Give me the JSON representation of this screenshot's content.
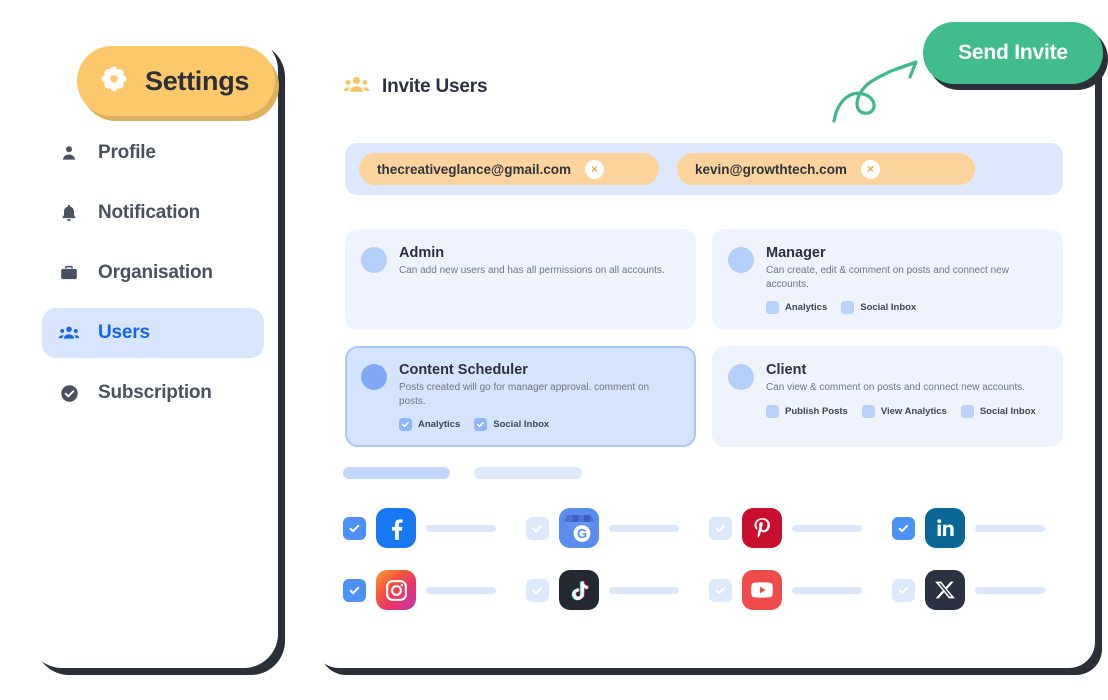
{
  "sidebar": {
    "header": {
      "label": "Settings",
      "icon": "flower-gear-icon",
      "bg": "#fcc86a"
    },
    "items": [
      {
        "label": "Profile",
        "icon": "person-icon",
        "active": false
      },
      {
        "label": "Notification",
        "icon": "bell-icon",
        "active": false
      },
      {
        "label": "Organisation",
        "icon": "briefcase-icon",
        "active": false
      },
      {
        "label": "Users",
        "icon": "people-group-icon",
        "active": true
      },
      {
        "label": "Subscription",
        "icon": "check-circle-icon",
        "active": false
      }
    ],
    "active_color": "#1566e8",
    "active_bg": "#d7e5ff"
  },
  "panel": {
    "header": {
      "title": "Invite Users",
      "icon": "people-group-icon",
      "icon_color": "#fbc35f"
    },
    "send_invite": {
      "label": "Send Invite",
      "color": "#41bd8d"
    },
    "emails": [
      {
        "value": "thecreativeglance@gmail.com",
        "remove": "×"
      },
      {
        "value": "kevin@growthtech.com",
        "remove": "×"
      }
    ],
    "roles": [
      {
        "name": "Admin",
        "description": "Can add new users and has all permissions on all accounts.",
        "selected": false,
        "permissions": []
      },
      {
        "name": "Manager",
        "description": "Can create, edit & comment on posts and connect new accounts.",
        "selected": false,
        "permissions": [
          {
            "label": "Analytics",
            "checked": false
          },
          {
            "label": "Social Inbox",
            "checked": false
          }
        ]
      },
      {
        "name": "Content Scheduler",
        "description": "Posts created will go for manager approval. comment on posts.",
        "selected": true,
        "permissions": [
          {
            "label": "Analytics",
            "checked": true
          },
          {
            "label": "Social Inbox",
            "checked": true
          }
        ]
      },
      {
        "name": "Client",
        "description": "Can view & comment on posts and connect new accounts.",
        "selected": false,
        "permissions": [
          {
            "label": "Publish Posts",
            "checked": false
          },
          {
            "label": "View Analytics",
            "checked": false
          },
          {
            "label": "Social Inbox",
            "checked": false
          }
        ]
      }
    ],
    "accounts": [
      {
        "icon": "facebook-icon",
        "checked": true
      },
      {
        "icon": "google-business-icon",
        "checked": false
      },
      {
        "icon": "pinterest-icon",
        "checked": false
      },
      {
        "icon": "linkedin-icon",
        "checked": true
      },
      {
        "icon": "instagram-icon",
        "checked": true
      },
      {
        "icon": "tiktok-icon",
        "checked": false
      },
      {
        "icon": "youtube-icon",
        "checked": false
      },
      {
        "icon": "x-twitter-icon",
        "checked": false
      }
    ]
  }
}
